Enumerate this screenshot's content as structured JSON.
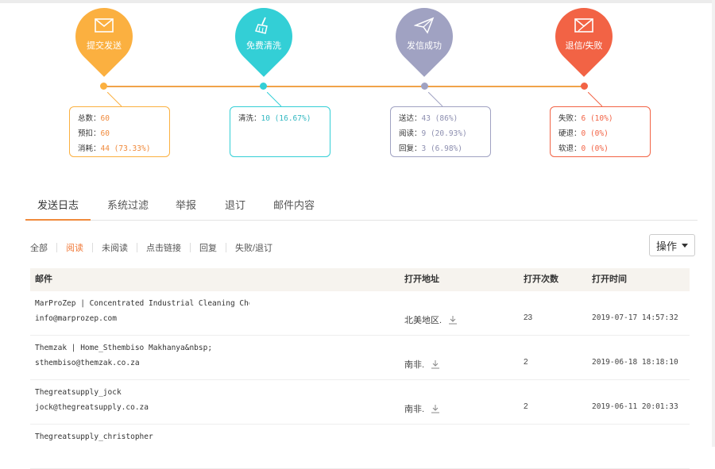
{
  "stages": [
    {
      "key": "submit",
      "label": "提交发送",
      "color": "#fbb040",
      "icon": "envelope-icon",
      "rows": [
        {
          "k": "总数：",
          "v": "60"
        },
        {
          "k": "预扣：",
          "v": "60"
        },
        {
          "k": "消耗：",
          "v": "44 (73.33%)"
        }
      ]
    },
    {
      "key": "clean",
      "label": "免费清洗",
      "color": "#33cfd6",
      "icon": "broom-icon",
      "rows": [
        {
          "k": "清洗：",
          "v": "10 (16.67%)"
        }
      ]
    },
    {
      "key": "success",
      "label": "发信成功",
      "color": "#a0a2c2",
      "icon": "paper-plane-icon",
      "rows": [
        {
          "k": "送达：",
          "v": "43 (86%)"
        },
        {
          "k": "阅读：",
          "v": "9 (20.93%)"
        },
        {
          "k": "回复：",
          "v": "3 (6.98%)"
        }
      ]
    },
    {
      "key": "fail",
      "label": "退信/失败",
      "color": "#f26345",
      "icon": "rejected-mail-icon",
      "rows": [
        {
          "k": "失败：",
          "v": "6 (10%)"
        },
        {
          "k": "硬退：",
          "v": "0 (0%)"
        },
        {
          "k": "软退：",
          "v": "0 (0%)"
        }
      ]
    }
  ],
  "tabs": [
    "发送日志",
    "系统过滤",
    "举报",
    "退订",
    "邮件内容"
  ],
  "filters": [
    "全部",
    "阅读",
    "未阅读",
    "点击链接",
    "回复",
    "失败/退订"
  ],
  "operation_label": "操作",
  "table": {
    "headers": {
      "mail": "邮件",
      "location": "打开地址",
      "count": "打开次数",
      "time": "打开时间"
    },
    "rows": [
      {
        "subject": "MarProZep | Concentrated Industrial Cleaning Che…",
        "email": "info@marprozep.com",
        "location": "北美地区.",
        "count": "23",
        "time": "2019-07-17 14:57:32"
      },
      {
        "subject": "Themzak | Home_Sthembiso Makhanya&nbsp;",
        "email": "sthembiso@themzak.co.za",
        "location": "南非.",
        "count": "2",
        "time": "2019-06-18 18:18:10"
      },
      {
        "subject": "Thegreatsupply_jock",
        "email": "jock@thegreatsupply.co.za",
        "location": "南非.",
        "count": "2",
        "time": "2019-06-11 20:01:33"
      },
      {
        "subject": "Thegreatsupply_christopher",
        "email": "",
        "location": "",
        "count": "",
        "time": ""
      }
    ]
  },
  "colors": {
    "accent": "#f08a3c",
    "timeline": "#f0a34a",
    "active_filter": "#f07a3a",
    "header_bg": "#f6f3ee"
  }
}
